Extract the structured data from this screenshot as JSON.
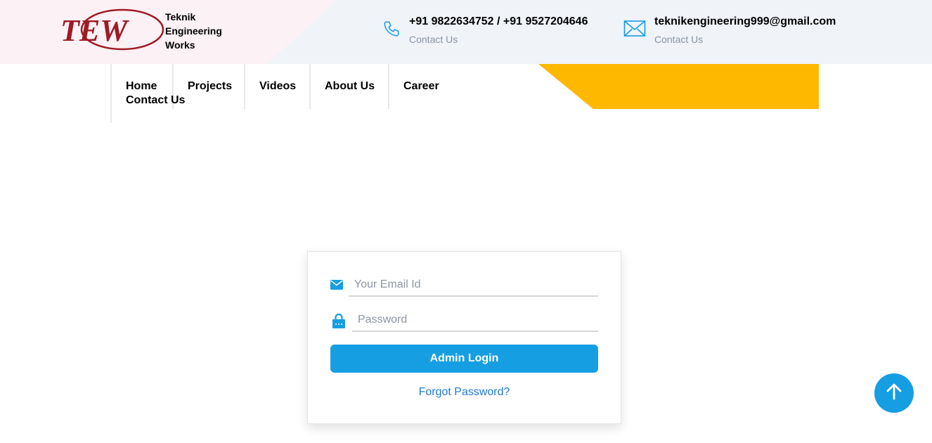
{
  "header": {
    "logo_mark": "TEW",
    "brand_lines": [
      "Teknik",
      "Engineering",
      "Works"
    ],
    "phone": {
      "icon": "phone-icon",
      "value": "+91 9822634752 / +91 9527204646",
      "caption": "Contact Us"
    },
    "email": {
      "icon": "envelope-icon",
      "value": "teknikengineering999@gmail.com",
      "caption": "Contact Us"
    }
  },
  "nav": {
    "items": [
      {
        "label": "Home"
      },
      {
        "label": "Projects"
      },
      {
        "label": "Videos"
      },
      {
        "label": "About Us"
      },
      {
        "label": "Career"
      },
      {
        "label": "Contact Us"
      }
    ]
  },
  "login": {
    "email_placeholder": "Your Email Id",
    "email_value": "",
    "email_icon": "envelope-icon",
    "password_placeholder": "Password",
    "password_value": "",
    "password_icon": "lock-icon",
    "submit_label": "Admin Login",
    "forgot_label": "Forgot Password?"
  },
  "scroll_top": {
    "icon": "arrow-up-icon"
  },
  "colors": {
    "accent_blue": "#169ee3",
    "link_blue": "#1f7ad1",
    "accent_yellow": "#ffb800",
    "logo_red": "#9e1b25",
    "topbar_bg": "#f0f3f8",
    "topbar_pink": "#fcf1f5"
  }
}
